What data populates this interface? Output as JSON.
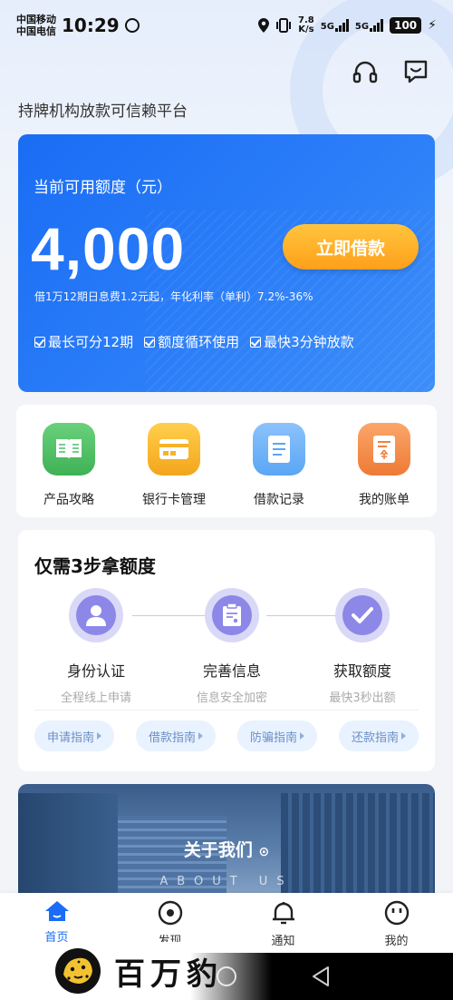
{
  "status_bar": {
    "carrier_1": "中国移动",
    "carrier_2": "中国电信",
    "time": "10:29",
    "net_speed_top": "7.8",
    "net_speed_bottom": "K/s",
    "network_1": "5G",
    "network_2": "5G",
    "battery": "100"
  },
  "header": {
    "subtitle": "持牌机构放款可信赖平台"
  },
  "credit_card": {
    "label": "当前可用额度（元）",
    "amount": "4,000",
    "borrow_button": "立即借款",
    "rate_note": "借1万12期日息费1.2元起，年化利率（单利）7.2%-36%",
    "features": [
      "最长可分12期",
      "额度循环使用",
      "最快3分钟放款"
    ]
  },
  "quick_entries": [
    {
      "label": "产品攻略",
      "icon": "book-icon",
      "color": "#4cbe62"
    },
    {
      "label": "银行卡管理",
      "icon": "bank-card-icon",
      "color": "#f6b22a"
    },
    {
      "label": "借款记录",
      "icon": "document-icon",
      "color": "#5aa6f5"
    },
    {
      "label": "我的账单",
      "icon": "bill-icon",
      "color": "#f0823f"
    }
  ],
  "steps": {
    "title": "仅需3步拿额度",
    "items": [
      {
        "title": "身份认证",
        "sub": "全程线上申请"
      },
      {
        "title": "完善信息",
        "sub": "信息安全加密"
      },
      {
        "title": "获取额度",
        "sub": "最快3秒出额"
      }
    ],
    "guides": [
      "申请指南",
      "借款指南",
      "防骗指南",
      "还款指南"
    ]
  },
  "about": {
    "title": "关于我们",
    "sub": "ABOUT US"
  },
  "tabbar": {
    "items": [
      {
        "label": "首页",
        "active": true
      },
      {
        "label": "发现",
        "active": false
      },
      {
        "label": "通知",
        "active": false
      },
      {
        "label": "我的",
        "active": false
      }
    ]
  },
  "watermark": {
    "text": "百万豹"
  },
  "colors": {
    "primary": "#1a6df4",
    "button_orange": "#ffa51f",
    "step_purple": "#8d87e8"
  }
}
